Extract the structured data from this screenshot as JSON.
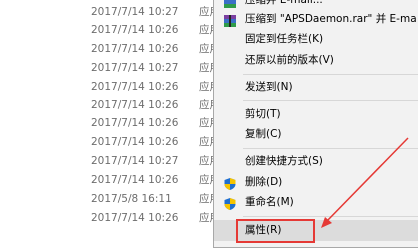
{
  "file_rows": [
    {
      "date": "2017/7/14 10:27",
      "type": "应用"
    },
    {
      "date": "2017/7/14 10:26",
      "type": "应用"
    },
    {
      "date": "2017/7/14 10:26",
      "type": "应用"
    },
    {
      "date": "2017/7/14 10:27",
      "type": "应用"
    },
    {
      "date": "2017/7/14 10:26",
      "type": "应用"
    },
    {
      "date": "2017/7/14 10:26",
      "type": "应用"
    },
    {
      "date": "2017/7/14 10:26",
      "type": "应用"
    },
    {
      "date": "2017/7/14 10:26",
      "type": "应用"
    },
    {
      "date": "2017/7/14 10:27",
      "type": "应用"
    },
    {
      "date": "2017/7/14 10:26",
      "type": "应用"
    },
    {
      "date": "2017/5/8 16:11",
      "type": "应用"
    },
    {
      "date": "2017/7/14 10:26",
      "type": "应用"
    }
  ],
  "context_menu": {
    "items": {
      "add_to_email": "压缩并 E-mail...",
      "compress_to_rar_email": "压缩到 \"APSDaemon.rar\" 并 E-ma",
      "pin_taskbar": "固定到任务栏(K)",
      "restore_previous": "还原以前的版本(V)",
      "send_to": "发送到(N)",
      "cut": "剪切(T)",
      "copy": "复制(C)",
      "create_shortcut": "创建快捷方式(S)",
      "delete": "删除(D)",
      "rename": "重命名(M)",
      "properties": "属性(R)"
    }
  },
  "colors": {
    "annotation": "#e53935",
    "rar_icon": "#7b3fa0",
    "shield_blue": "#1e6fd0",
    "shield_yellow": "#f5c400"
  }
}
